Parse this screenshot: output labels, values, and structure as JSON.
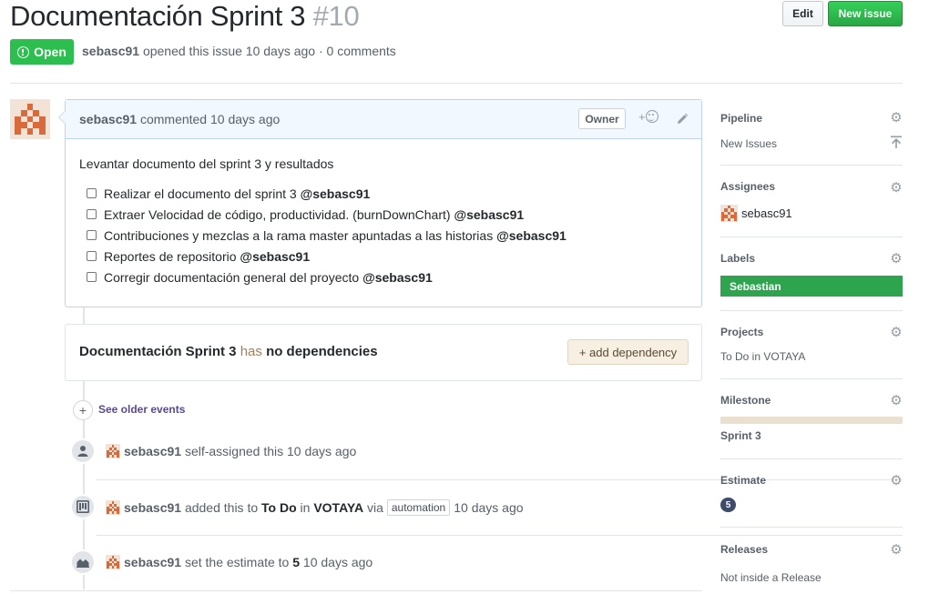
{
  "issue": {
    "title": "Documentación Sprint 3",
    "number": "#10",
    "state": "Open",
    "author": "sebasc91",
    "opened_text": "opened this issue 10 days ago · 0 comments"
  },
  "header": {
    "edit_label": "Edit",
    "new_issue_label": "New issue"
  },
  "comment": {
    "author": "sebasc91",
    "action": "commented 10 days ago",
    "owner_label": "Owner",
    "reaction_plus": "+",
    "intro": "Levantar documento del sprint 3 y resultados",
    "tasks": [
      {
        "text": "Realizar el documento del sprint 3 ",
        "mention": "@sebasc91"
      },
      {
        "text": "Extraer Velocidad de código, productividad. (burnDownChart) ",
        "mention": "@sebasc91"
      },
      {
        "text": "Contribuciones y mezclas a la rama master apuntadas a las historias ",
        "mention": "@sebasc91"
      },
      {
        "text": "Reportes de repositorio ",
        "mention": "@sebasc91"
      },
      {
        "text": "Corregir documentación general del proyecto ",
        "mention": "@sebasc91"
      }
    ]
  },
  "dependencies": {
    "issue_name": "Documentación Sprint 3",
    "has": " has ",
    "status": "no dependencies",
    "add_label": "+ add dependency"
  },
  "timeline": {
    "older_icon": "+",
    "older_label": "See older events",
    "events": [
      {
        "user": "sebasc91",
        "text": " self-assigned this 10 days ago"
      },
      {
        "user": "sebasc91",
        "pre": " added this to ",
        "pipeline": "To Do",
        "mid": " in ",
        "repo": "VOTAYA",
        "via": " via",
        "pill": "automation",
        "post": "10 days ago"
      },
      {
        "user": "sebasc91",
        "pre": " set the estimate to ",
        "value": "5",
        "post": " 10 days ago"
      }
    ]
  },
  "sidebar": {
    "pipeline": {
      "heading": "Pipeline",
      "value": "New Issues"
    },
    "assignees": {
      "heading": "Assignees",
      "value": "sebasc91"
    },
    "labels": {
      "heading": "Labels",
      "value": "Sebastian"
    },
    "projects": {
      "heading": "Projects",
      "value": "To Do in VOTAYA"
    },
    "milestone": {
      "heading": "Milestone",
      "value": "Sprint 3",
      "progress": 0
    },
    "estimate": {
      "heading": "Estimate",
      "value": "5"
    },
    "releases": {
      "heading": "Releases",
      "value": "Not inside a Release"
    }
  },
  "colors": {
    "open_green": "#2cbe4e",
    "label_green": "#2ea44f",
    "comment_header": "#f1f8ff",
    "estimate_badge": "#3f4b6b"
  },
  "icons": [
    "issue-opened-icon",
    "smiley-icon",
    "pencil-icon",
    "gear-icon",
    "arrow-to-top-icon",
    "person-icon",
    "project-icon",
    "graph-icon",
    "plus-icon"
  ]
}
